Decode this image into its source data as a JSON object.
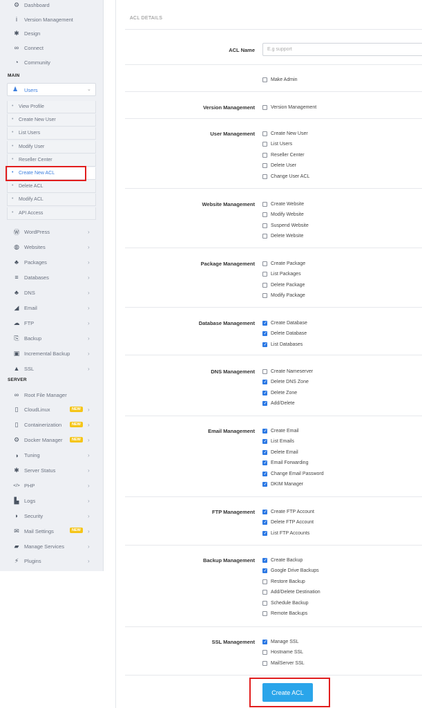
{
  "sidebar": {
    "top_items": [
      {
        "label": "Dashboard",
        "icon": "dashboard-icon",
        "glyph": "⚙"
      },
      {
        "label": "Version Management",
        "icon": "info-icon",
        "glyph": "i"
      },
      {
        "label": "Design",
        "icon": "gear-icon",
        "glyph": "✱"
      },
      {
        "label": "Connect",
        "icon": "link-icon",
        "glyph": "∞"
      },
      {
        "label": "Community",
        "icon": "chat-icon",
        "glyph": "◔"
      }
    ],
    "main_heading": "MAIN",
    "users_label": "Users",
    "users_submenu": [
      "View Profile",
      "Create New User",
      "List Users",
      "Modify User",
      "Reseller Center",
      "Create New ACL",
      "Delete ACL",
      "Modify ACL",
      "API Access"
    ],
    "active_submenu": "Create New ACL",
    "main_items": [
      {
        "label": "WordPress",
        "icon": "wordpress-icon",
        "glyph": "Ⓦ"
      },
      {
        "label": "Websites",
        "icon": "globe-icon",
        "glyph": "◍"
      },
      {
        "label": "Packages",
        "icon": "packages-icon",
        "glyph": "♣"
      },
      {
        "label": "Databases",
        "icon": "database-icon",
        "glyph": "≡"
      },
      {
        "label": "DNS",
        "icon": "sitemap-icon",
        "glyph": "♣"
      },
      {
        "label": "Email",
        "icon": "send-icon",
        "glyph": "◢"
      },
      {
        "label": "FTP",
        "icon": "cloud-upload-icon",
        "glyph": "☁"
      },
      {
        "label": "Backup",
        "icon": "backup-icon",
        "glyph": "⎘"
      },
      {
        "label": "Incremental Backup",
        "icon": "save-icon",
        "glyph": "▣"
      },
      {
        "label": "SSL",
        "icon": "lock-icon",
        "glyph": "▲"
      }
    ],
    "server_heading": "SERVER",
    "server_items": [
      {
        "label": "Root File Manager",
        "icon": "link-icon",
        "glyph": "∞",
        "chevron": false
      },
      {
        "label": "CloudLinux",
        "icon": "file-icon",
        "glyph": "▯",
        "badge": "NEW",
        "chevron": true
      },
      {
        "label": "Containerization",
        "icon": "file-icon",
        "glyph": "▯",
        "badge": "NEW",
        "chevron": true
      },
      {
        "label": "Docker Manager",
        "icon": "cogs-icon",
        "glyph": "⚙",
        "badge": "NEW",
        "chevron": true
      },
      {
        "label": "Tuning",
        "icon": "adjust-icon",
        "glyph": "◑",
        "chevron": true
      },
      {
        "label": "Server Status",
        "icon": "gear-icon",
        "glyph": "✱",
        "chevron": true
      },
      {
        "label": "PHP",
        "icon": "code-icon",
        "glyph": "</>",
        "chevron": true
      },
      {
        "label": "Logs",
        "icon": "file-icon",
        "glyph": "▙",
        "chevron": true
      },
      {
        "label": "Security",
        "icon": "shield-icon",
        "glyph": "◗",
        "chevron": true
      },
      {
        "label": "Mail Settings",
        "icon": "envelope-icon",
        "glyph": "✉",
        "badge": "NEW",
        "chevron": true
      },
      {
        "label": "Manage Services",
        "icon": "folder-icon",
        "glyph": "▰",
        "chevron": true
      },
      {
        "label": "Plugins",
        "icon": "plug-icon",
        "glyph": "⚡",
        "chevron": true
      }
    ]
  },
  "panel": {
    "title": "ACL DETAILS",
    "acl_name_label": "ACL Name",
    "acl_name_placeholder": "E.g support",
    "acl_name_value": "",
    "make_admin": {
      "label": "Make Admin",
      "checked": false
    },
    "sections": [
      {
        "label": "Version Management",
        "options": [
          {
            "label": "Version Management",
            "checked": false
          }
        ]
      },
      {
        "label": "User Management",
        "options": [
          {
            "label": "Create New User",
            "checked": false
          },
          {
            "label": "List Users",
            "checked": false
          },
          {
            "label": "Reseller Center",
            "checked": false
          },
          {
            "label": "Delete User",
            "checked": false
          },
          {
            "label": "Change User ACL",
            "checked": false
          }
        ]
      },
      {
        "label": "Website Management",
        "options": [
          {
            "label": "Create Website",
            "checked": false
          },
          {
            "label": "Modify Website",
            "checked": false
          },
          {
            "label": "Suspend Website",
            "checked": false
          },
          {
            "label": "Delete Website",
            "checked": false
          }
        ]
      },
      {
        "label": "Package Management",
        "options": [
          {
            "label": "Create Package",
            "checked": false
          },
          {
            "label": "List Packages",
            "checked": false
          },
          {
            "label": "Delete Package",
            "checked": false
          },
          {
            "label": "Modify Package",
            "checked": false
          }
        ]
      },
      {
        "label": "Database Management",
        "options": [
          {
            "label": "Create Database",
            "checked": true
          },
          {
            "label": "Delete Database",
            "checked": true
          },
          {
            "label": "List Databases",
            "checked": true
          }
        ]
      },
      {
        "label": "DNS Management",
        "options": [
          {
            "label": "Create Nameserver",
            "checked": false
          },
          {
            "label": "Delete DNS Zone",
            "checked": true
          },
          {
            "label": "Delete Zone",
            "checked": true
          },
          {
            "label": "Add/Delete",
            "checked": true
          }
        ]
      },
      {
        "label": "Email Management",
        "options": [
          {
            "label": "Create Email",
            "checked": true
          },
          {
            "label": "List Emails",
            "checked": true
          },
          {
            "label": "Delete Email",
            "checked": true
          },
          {
            "label": "Email Forwarding",
            "checked": true
          },
          {
            "label": "Change Email Password",
            "checked": true
          },
          {
            "label": "DKIM Manager",
            "checked": true
          }
        ]
      },
      {
        "label": "FTP Management",
        "options": [
          {
            "label": "Create FTP Account",
            "checked": true
          },
          {
            "label": "Delete FTP Account",
            "checked": true
          },
          {
            "label": "List FTP Accounts",
            "checked": true
          }
        ]
      },
      {
        "label": "Backup Management",
        "options": [
          {
            "label": "Create Backup",
            "checked": true
          },
          {
            "label": "Google Drive Backups",
            "checked": true
          },
          {
            "label": "Restore Backup",
            "checked": false
          },
          {
            "label": "Add/Delete Destination",
            "checked": false
          },
          {
            "label": "Schedule Backup",
            "checked": false
          },
          {
            "label": "Remote Backups",
            "checked": false
          }
        ]
      },
      {
        "label": "SSL Management",
        "options": [
          {
            "label": "Manage SSL",
            "checked": true
          },
          {
            "label": "Hostname SSL",
            "checked": false
          },
          {
            "label": "MailServer SSL",
            "checked": false
          }
        ]
      }
    ],
    "submit_label": "Create ACL"
  },
  "colors": {
    "accent": "#2b78e4",
    "button": "#2aa5ea",
    "highlight": "#e11d1d",
    "badge": "#f5c518"
  }
}
